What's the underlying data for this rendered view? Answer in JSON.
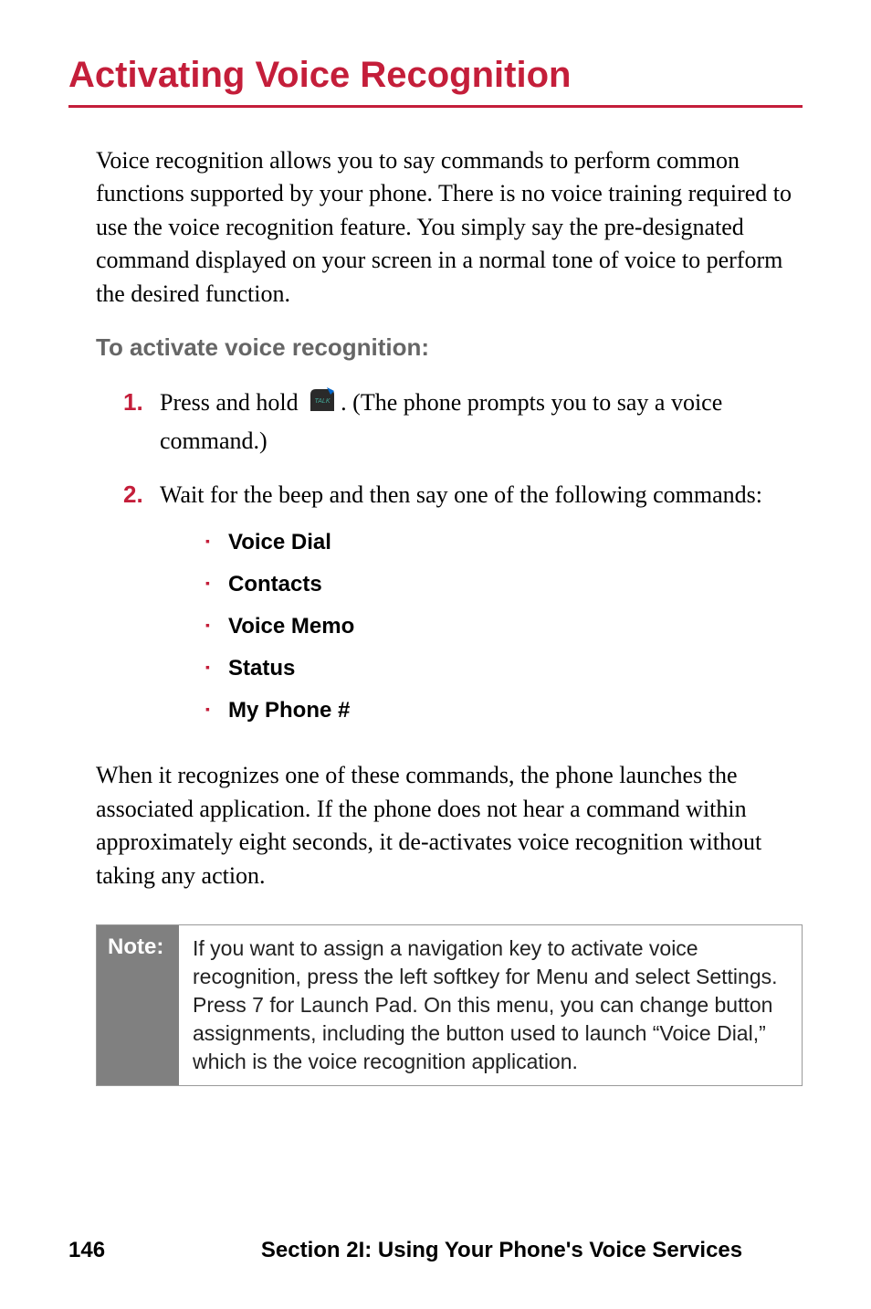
{
  "title": "Activating Voice Recognition",
  "intro": "Voice recognition allows you to say commands to perform common functions supported by your phone. There is no voice training required to use the voice recognition feature. You simply say the pre-designated command displayed on your screen in a normal tone of voice to perform the desired function.",
  "subheading": "To activate voice recognition:",
  "steps": [
    {
      "number": "1.",
      "text_before": "Press and hold ",
      "text_after": ". (The phone prompts you to say a voice command.)",
      "has_icon": true
    },
    {
      "number": "2.",
      "text": "Wait for the beep and then say one of the following commands:",
      "sublist": [
        "Voice Dial",
        "Contacts",
        "Voice Memo",
        "Status",
        "My Phone #"
      ]
    }
  ],
  "closing": "When it recognizes one of these commands, the phone launches the associated application. If the phone does not hear a command within approximately eight seconds, it de-activates voice recognition without taking any action.",
  "note": {
    "label": "Note:",
    "text": "If you want to assign a navigation key to activate voice recognition, press the left softkey for Menu and select Settings. Press 7 for Launch Pad. On this menu, you can change button assignments, including the button used to launch “Voice Dial,” which is the voice recognition application."
  },
  "footer": {
    "page": "146",
    "section": "Section 2I: Using Your Phone's Voice Services"
  }
}
